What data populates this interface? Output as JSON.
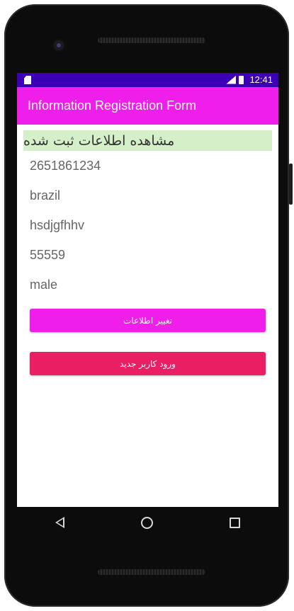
{
  "statusbar": {
    "time": "12:41",
    "network": "LTE"
  },
  "appbar": {
    "title": "Information Registration Form"
  },
  "content": {
    "header": "مشاهده اطلاعات ثبت شده",
    "fields": [
      "2651861234",
      "brazil",
      "hsdjgfhhv",
      "55559",
      "male"
    ]
  },
  "buttons": {
    "edit_label": "تغییر اطلاعات",
    "new_user_label": "ورود کاربر جدید"
  },
  "colors": {
    "status_bar": "#3b00b6",
    "app_bar": "#ef1eea",
    "header_bg": "#d5f0c9",
    "edit_button": "#ef1eea",
    "new_user_button": "#e91e63"
  },
  "icons": {
    "status_left": "sd-card-icon",
    "status_right": [
      "signal-icon",
      "battery-icon"
    ],
    "nav": [
      "back-icon",
      "home-icon",
      "recents-icon"
    ]
  }
}
